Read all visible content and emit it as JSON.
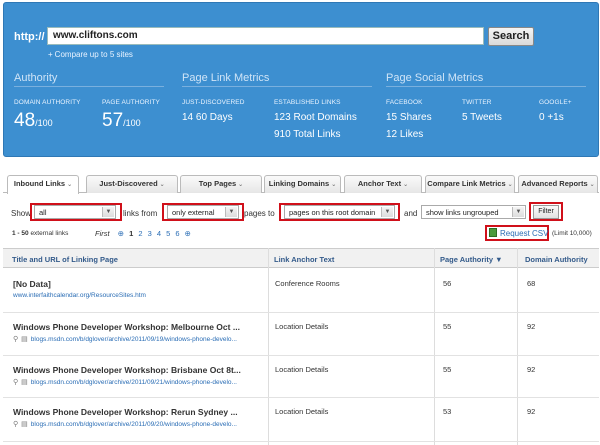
{
  "search": {
    "protocol": "http://",
    "url": "www.cliftons.com",
    "button": "Search",
    "compare": "Compare up to 5 sites"
  },
  "authority": {
    "title": "Authority",
    "domain_label": "DOMAIN AUTHORITY",
    "domain_value": "48",
    "domain_suffix": "/100",
    "page_label": "PAGE AUTHORITY",
    "page_value": "57",
    "page_suffix": "/100"
  },
  "link_metrics": {
    "title": "Page Link Metrics",
    "just_label": "JUST-DISCOVERED",
    "just_num": "14",
    "just_unit": "60 Days",
    "est_label": "ESTABLISHED LINKS",
    "root_num": "123",
    "root_unit": "Root Domains",
    "total_num": "910",
    "total_unit": "Total Links"
  },
  "social": {
    "title": "Page Social Metrics",
    "fb_label": "FACEBOOK",
    "fb_shares_num": "15",
    "fb_shares_unit": "Shares",
    "fb_likes_num": "12",
    "fb_likes_unit": "Likes",
    "tw_label": "TWITTER",
    "tw_num": "5",
    "tw_unit": "Tweets",
    "gp_label": "GOOGLE+",
    "gp_num": "0",
    "gp_unit": "+1s"
  },
  "tabs": [
    "Inbound Links",
    "Just-Discovered",
    "Top Pages",
    "Linking Domains",
    "Anchor Text",
    "Compare Link Metrics",
    "Advanced Reports"
  ],
  "filters": {
    "show": "Show",
    "show_value": "all",
    "links_from": "links from",
    "from_value": "only external",
    "pages_to": "pages to",
    "to_value": "pages on this root domain",
    "and": "and",
    "group_value": "show links ungrouped",
    "filter_button": "Filter"
  },
  "results": {
    "range": "1 - 50",
    "label": "external links",
    "first": "First",
    "pages": [
      "1",
      "2",
      "3",
      "4",
      "5",
      "6"
    ]
  },
  "export": {
    "csv": "Request CSV",
    "limit": "(Limit 10,000)"
  },
  "table": {
    "headers": [
      "Title and URL of Linking Page",
      "Link Anchor Text",
      "Page Authority ▼",
      "Domain Authority"
    ],
    "rows": [
      {
        "title": "[No Data]",
        "url": "www.interfaithcalendar.org/ResourceSites.htm",
        "anchor": "Conference Rooms",
        "pa": "56",
        "da": "68"
      },
      {
        "title": "Windows Phone Developer Workshop: Melbourne Oct ...",
        "url": "blogs.msdn.com/b/dglover/archive/2011/09/19/windows-phone-develo...",
        "anchor": "Location Details",
        "pa": "55",
        "da": "92"
      },
      {
        "title": "Windows Phone Developer Workshop: Brisbane Oct 8t...",
        "url": "blogs.msdn.com/b/dglover/archive/2011/09/21/windows-phone-develo...",
        "anchor": "Location Details",
        "pa": "55",
        "da": "92"
      },
      {
        "title": "Windows Phone Developer Workshop: Rerun Sydney ...",
        "url": "blogs.msdn.com/b/dglover/archive/2011/09/20/windows-phone-develo...",
        "anchor": "Location Details",
        "pa": "53",
        "da": "92"
      }
    ]
  },
  "colors": {
    "panel": "#3d8fd0",
    "highlight": "#d0101a",
    "link": "#2a6db5"
  }
}
